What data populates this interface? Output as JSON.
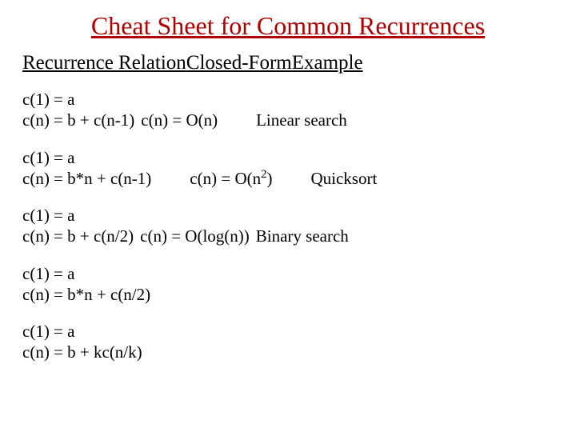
{
  "title": "Cheat Sheet for Common Recurrences",
  "headers": {
    "col1": "Recurrence Relation",
    "col2": "Closed-Form",
    "col3": "Example"
  },
  "rows": [
    {
      "base": "c(1) = a",
      "rec": "c(n) = b + c(n-1)",
      "closed": "c(n) = O(n)",
      "example": "Linear search"
    },
    {
      "base": "c(1) = a",
      "rec": "c(n) = b*n + c(n-1)",
      "closed_pre": "c(n) = O(n",
      "closed_sup": "2",
      "closed_post": ")",
      "example": "Quicksort"
    },
    {
      "base": "c(1) = a",
      "rec": "c(n) = b + c(n/2)",
      "closed": "c(n) = O(log(n))",
      "example": "Binary search"
    },
    {
      "base": "c(1) = a",
      "rec": "c(n) = b*n + c(n/2)"
    },
    {
      "base": "c(1) = a",
      "rec": "c(n) = b + kc(n/k)"
    }
  ]
}
